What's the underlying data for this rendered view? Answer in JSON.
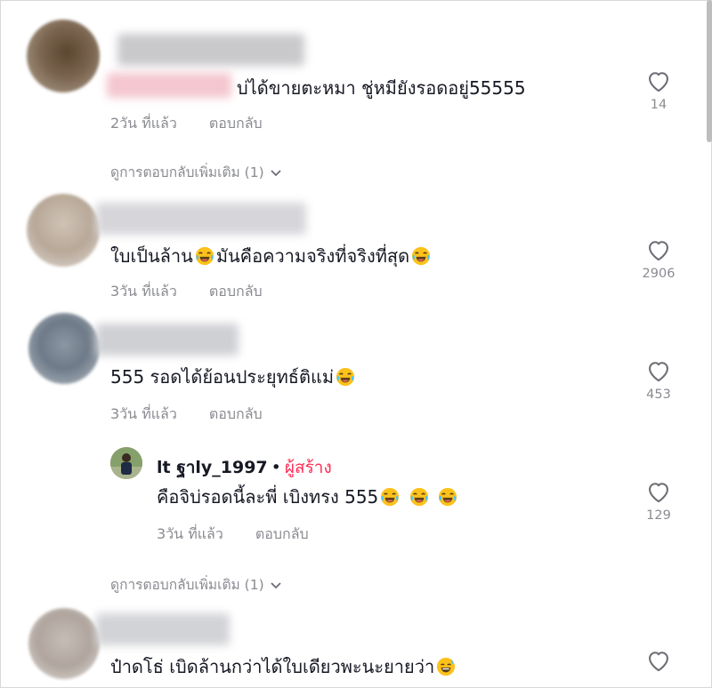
{
  "comments": [
    {
      "text": "บ่ได้ขายตะหมา ชู่หมียังรอดอยู่55555",
      "time": "2วัน ที่แล้ว",
      "reply": "ตอบกลับ",
      "likes": "14",
      "more_replies": "ดูการตอบกลับเพิ่มเติม (1)"
    },
    {
      "text_a": "ใบเป็นล้าน",
      "text_b": "มันคือความจริงที่จริงที่สุด",
      "time": "3วัน ที่แล้ว",
      "reply": "ตอบกลับ",
      "likes": "2906"
    },
    {
      "text": "555 รอดได้ย้อนประยุทธ์ติแม่",
      "time": "3วัน ที่แล้ว",
      "reply": "ตอบกลับ",
      "likes": "453",
      "creator_reply": {
        "username": "lt ฐาly_1997",
        "separator": "•",
        "creator_label": "ผู้สร้าง",
        "text": "คือจิบ่รอดนี้ละพี่ เบิงทรง 555",
        "time": "3วัน ที่แล้ว",
        "reply": "ตอบกลับ",
        "likes": "129"
      },
      "more_replies": "ดูการตอบกลับเพิ่มเติม (1)"
    },
    {
      "text": "ป๋าดโธ่ เบิดล้านกว่าได้ใบเดียวพะนะยายว่า"
    }
  ],
  "icons": {
    "like": "heart-outline-icon",
    "laugh_emoji": "tears-of-joy-emoji",
    "sweat_emoji": "grinning-sweat-emoji",
    "chevron": "chevron-down-icon"
  },
  "colors": {
    "creator": "#fe2c55",
    "meta": "#8a8b91",
    "text": "#161823"
  }
}
